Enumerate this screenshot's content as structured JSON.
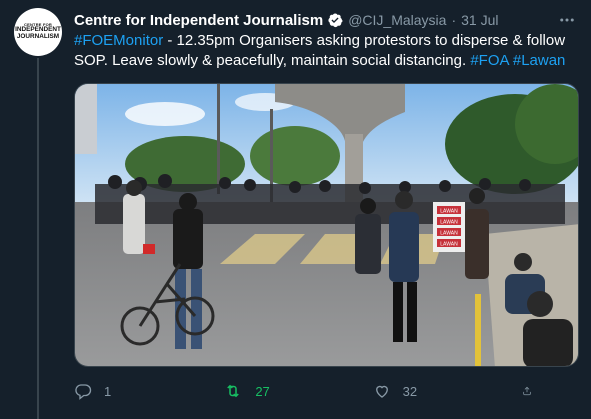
{
  "account": {
    "name": "Centre for Independent Journalism",
    "handle": "@CIJ_Malaysia",
    "separator": "·",
    "date": "31 Jul",
    "avatar_lines": [
      "CENTRE FOR",
      "INDEPENDENT",
      "JOURNALISM"
    ]
  },
  "tweet": {
    "hashtag1": "#FOEMonitor",
    "body": " - 12.35pm Organisers asking protestors to disperse & follow SOP. Leave slowly & peacefully, maintain social distancing. ",
    "hashtag2": "#FOA",
    "space": " ",
    "hashtag3": "#Lawan"
  },
  "media": {
    "poster_text": [
      "LAWAN",
      "LAWAN",
      "LAWAN",
      "LAWAN"
    ]
  },
  "actions": {
    "reply_count": "1",
    "retweet_count": "27",
    "like_count": "32"
  },
  "icons": {
    "verified": "verified-badge-icon",
    "more": "more-dots-icon",
    "reply": "reply-icon",
    "retweet": "retweet-icon",
    "like": "heart-icon",
    "share": "share-icon"
  },
  "colors": {
    "background": "#15202b",
    "link": "#1da1f2",
    "secondary_text": "#8899a6",
    "retweet_active": "#17bf63"
  }
}
